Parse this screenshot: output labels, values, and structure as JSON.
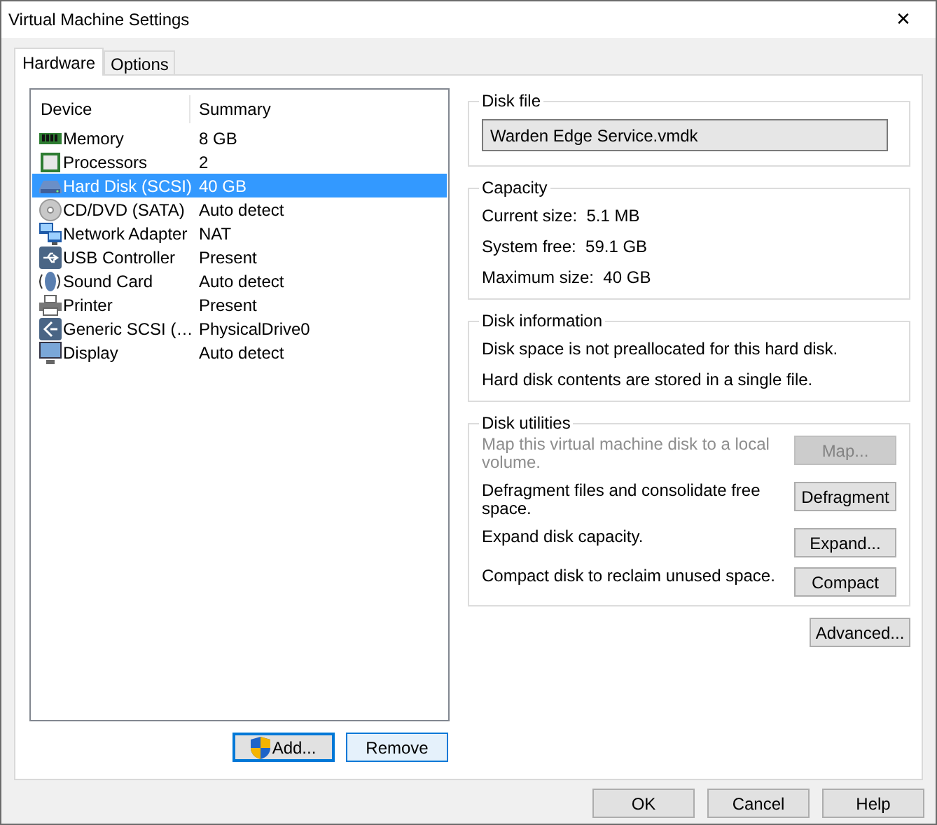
{
  "window": {
    "title": "Virtual Machine Settings",
    "close": "✕"
  },
  "tabs": [
    {
      "label": "Hardware",
      "selected": true
    },
    {
      "label": "Options",
      "selected": false
    }
  ],
  "device_list": {
    "columns": [
      "Device",
      "Summary"
    ],
    "rows": [
      {
        "kind": "memory",
        "device": "Memory",
        "summary": "8 GB",
        "selected": false
      },
      {
        "kind": "processor",
        "device": "Processors",
        "summary": "2",
        "selected": false
      },
      {
        "kind": "disk",
        "device": "Hard Disk (SCSI)",
        "summary": "40 GB",
        "selected": true
      },
      {
        "kind": "cd",
        "device": "CD/DVD (SATA)",
        "summary": "Auto detect",
        "selected": false
      },
      {
        "kind": "network",
        "device": "Network Adapter",
        "summary": "NAT",
        "selected": false
      },
      {
        "kind": "usb",
        "device": "USB Controller",
        "summary": "Present",
        "selected": false
      },
      {
        "kind": "sound",
        "device": "Sound Card",
        "summary": "Auto detect",
        "selected": false
      },
      {
        "kind": "printer",
        "device": "Printer",
        "summary": "Present",
        "selected": false
      },
      {
        "kind": "scsi",
        "device": "Generic SCSI (…",
        "summary": "PhysicalDrive0",
        "selected": false
      },
      {
        "kind": "display",
        "device": "Display",
        "summary": "Auto detect",
        "selected": false
      }
    ]
  },
  "list_buttons": [
    {
      "label": "Add...",
      "shield": true,
      "focused": true
    },
    {
      "label": "Remove",
      "shield": false,
      "focused": false
    }
  ],
  "disk_file": {
    "title": "Disk file",
    "value": "Warden Edge Service.vmdk"
  },
  "capacity": {
    "title": "Capacity",
    "lines": [
      "Current size:  5.1 MB",
      "System free:  59.1 GB",
      "Maximum size:  40 GB"
    ]
  },
  "disk_information": {
    "title": "Disk information",
    "lines": [
      "Disk space is not preallocated for this hard disk.",
      "Hard disk contents are stored in a single file."
    ]
  },
  "disk_utilities": {
    "title": "Disk utilities",
    "items": [
      {
        "text": "Map this virtual machine disk to a local volume.",
        "button": "Map...",
        "disabled": true
      },
      {
        "text": "Defragment files and consolidate free space.",
        "button": "Defragment",
        "disabled": false
      },
      {
        "text": "Expand disk capacity.",
        "button": "Expand...",
        "disabled": false
      },
      {
        "text": "Compact disk to reclaim unused space.",
        "button": "Compact",
        "disabled": false
      }
    ]
  },
  "advanced_button": "Advanced...",
  "dialog_buttons": [
    "OK",
    "Cancel",
    "Help"
  ]
}
